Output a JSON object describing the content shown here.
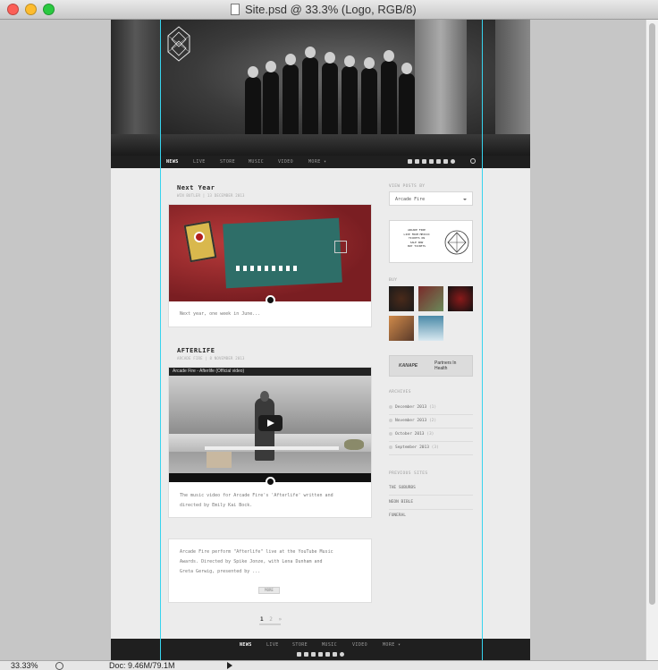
{
  "window": {
    "title": "Site.psd @ 33.3% (Logo, RGB/8)"
  },
  "site": {
    "nav": [
      {
        "label": "NEWS",
        "active": true
      },
      {
        "label": "LIVE"
      },
      {
        "label": "STORE"
      },
      {
        "label": "MUSIC"
      },
      {
        "label": "VIDEO"
      },
      {
        "label": "MORE ▾"
      }
    ],
    "footer_nav": [
      "NEWS",
      "LIVE",
      "STORE",
      "MUSIC",
      "VIDEO",
      "MORE ▾"
    ],
    "posts": [
      {
        "title": "Next Year",
        "meta": "WIN BUTLER | 13 DECEMBER 2013",
        "excerpt": "Next year, one week in June..."
      },
      {
        "title": "AFTERLIFE",
        "meta": "ARCADE FIRE | 8 NOVEMBER 2013",
        "video_title": "Arcade Fire - Afterlife (Official video)",
        "excerpt_lines": [
          "The music video for Arcade Fire's 'Afterlife' written and",
          "directed by Emily Kai Bock."
        ]
      },
      {
        "excerpt_lines": [
          "Arcade Fire perform \"Afterlife\" live at the YouTube Music",
          "Awards. Directed by Spike Jonze, with Lena Dunham and",
          "Greta Gerwig, presented by ..."
        ],
        "more_label": "MORE"
      }
    ],
    "pagination": [
      "1",
      "2",
      "»"
    ],
    "sidebar": {
      "view_posts_label": "VIEW POSTS BY",
      "filter_selected": "Arcade Fire",
      "tickets_ad_lines": [
        "ARCADE FIRE",
        "LIVE FROM MEXICO",
        "TICKETS ON",
        "SALE NOW",
        "BUY TICKETS"
      ],
      "buy_label": "BUY",
      "partners_left": "KANAPE",
      "partners_right": "Partners In Health",
      "archives_label": "ARCHIVES",
      "archives": [
        {
          "month": "December 2013",
          "count": "(1)"
        },
        {
          "month": "November 2013",
          "count": "(2)"
        },
        {
          "month": "October 2013",
          "count": "(3)"
        },
        {
          "month": "September 2013",
          "count": "(3)"
        }
      ],
      "previous_sites_label": "PREVIOUS SITES",
      "previous_sites": [
        "THE SUBURBS",
        "NEON BIBLE",
        "FUNERAL"
      ]
    }
  },
  "status": {
    "zoom": "33.33%",
    "doc": "Doc: 9.46M/79.1M"
  }
}
